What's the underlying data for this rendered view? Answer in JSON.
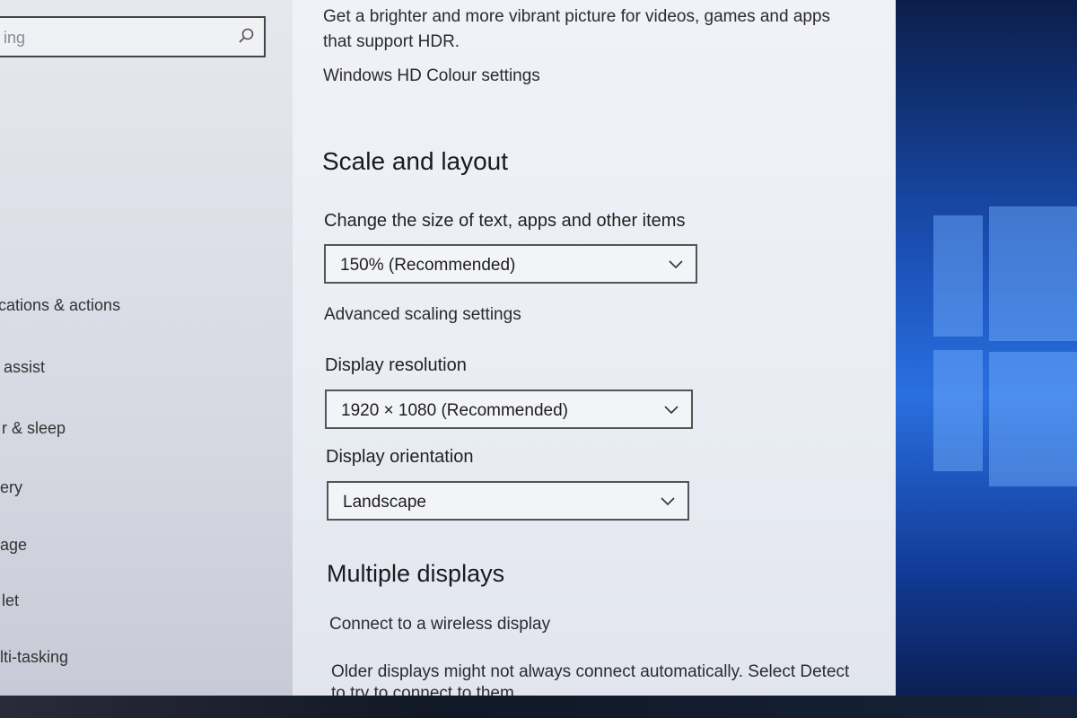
{
  "search": {
    "value": "ing"
  },
  "sidebar": {
    "items": [
      {
        "label": "cations & actions"
      },
      {
        "label": "assist"
      },
      {
        "label": "r & sleep"
      },
      {
        "label": "ery"
      },
      {
        "label": "age"
      },
      {
        "label": "let"
      },
      {
        "label": "lti-tasking"
      }
    ]
  },
  "hdr": {
    "description_line1": "Get a brighter and more vibrant picture for videos, games and apps",
    "description_line2": "that support HDR.",
    "link": "Windows HD Colour settings"
  },
  "scale_layout": {
    "title": "Scale and layout",
    "size_label": "Change the size of text, apps and other items",
    "size_value": "150% (Recommended)",
    "advanced_link": "Advanced scaling settings",
    "resolution_label": "Display resolution",
    "resolution_value": "1920 × 1080 (Recommended)",
    "orientation_label": "Display orientation",
    "orientation_value": "Landscape"
  },
  "multiple_displays": {
    "title": "Multiple displays",
    "wireless_link": "Connect to a wireless display",
    "note_line1": "Older displays might not always connect automatically. Select Detect",
    "note_line2": "to try to connect to them."
  },
  "colors": {
    "link": "#2f6fc4",
    "panel_bg": "#eceef4",
    "nav_bg": "#dcdfe7",
    "desktop_accent": "#2a6fe0"
  }
}
